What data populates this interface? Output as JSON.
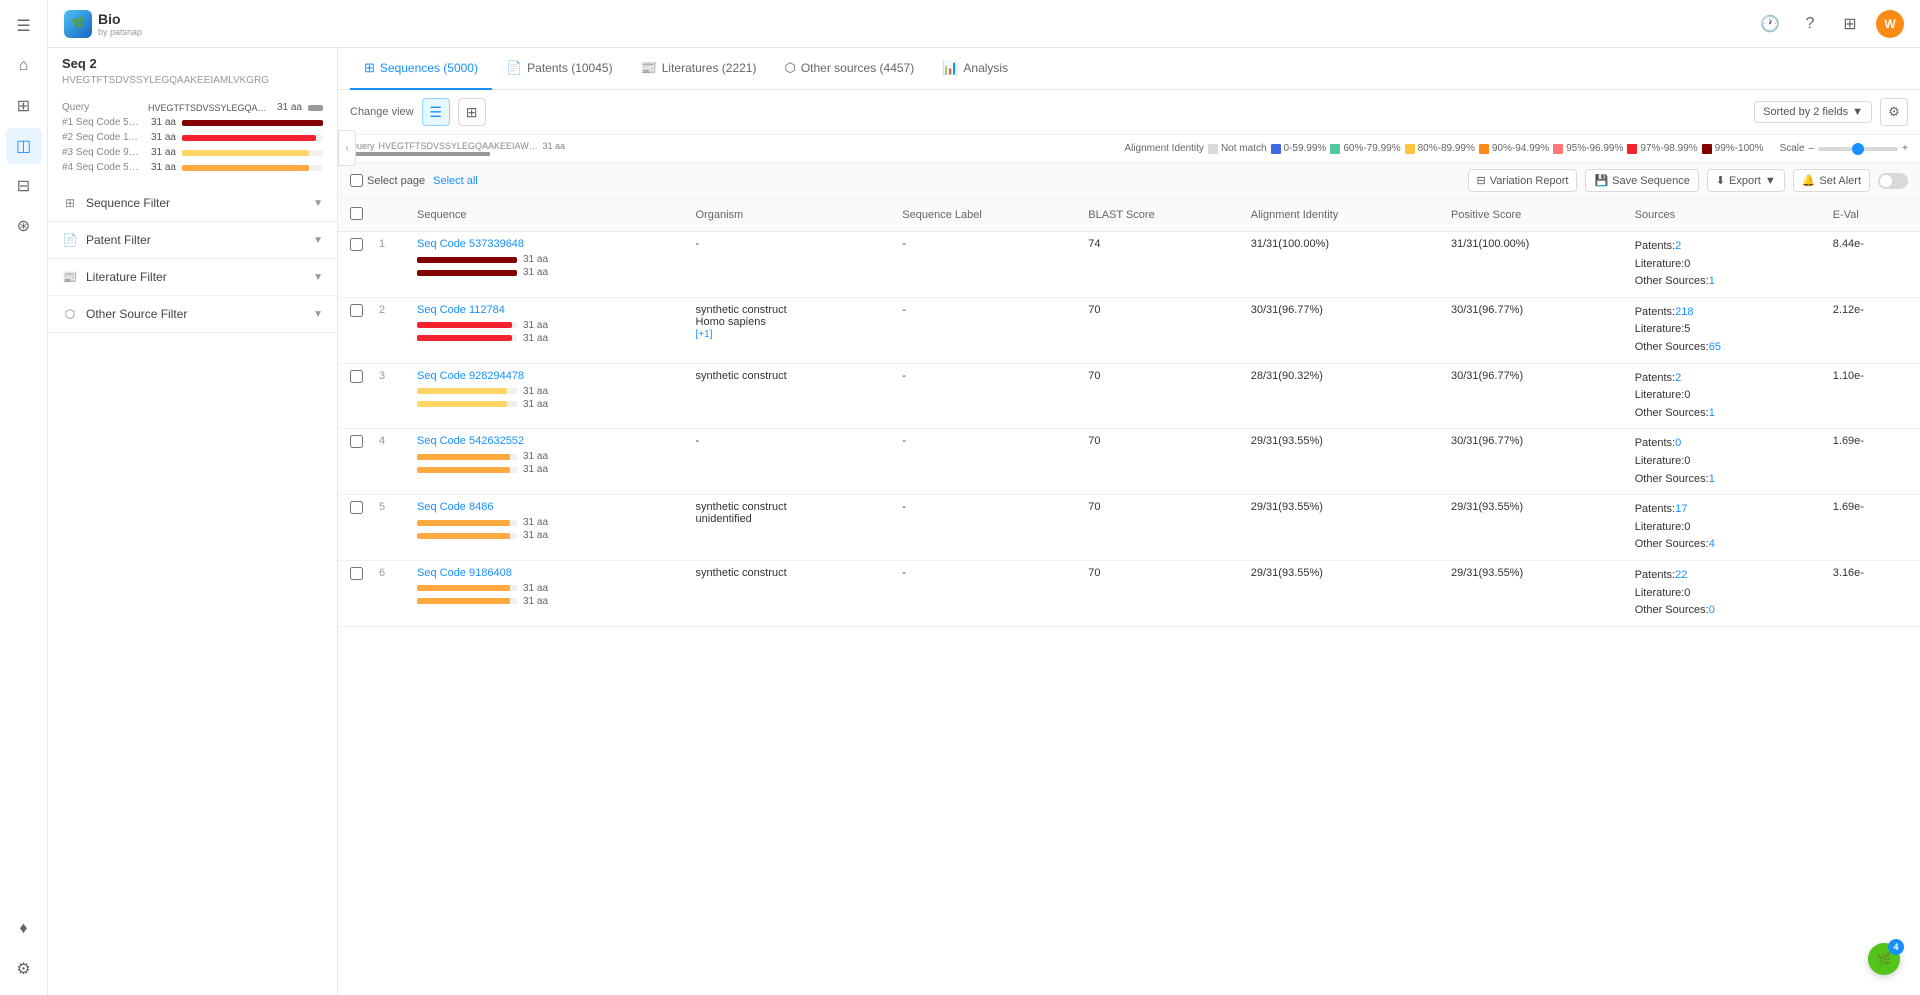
{
  "app": {
    "title": "Bio",
    "subtitle": "by patsnap",
    "user_initial": "W"
  },
  "query": {
    "name": "Seq 2",
    "sequence": "HVEGTFTSDVSSYLEGQAAKEEIAMLVKGRG"
  },
  "tabs": [
    {
      "id": "sequences",
      "label": "Sequences (5000)",
      "icon": "⊞",
      "active": true
    },
    {
      "id": "patents",
      "label": "Patents (10045)",
      "icon": "📄",
      "active": false
    },
    {
      "id": "literatures",
      "label": "Literatures (2221)",
      "icon": "📰",
      "active": false
    },
    {
      "id": "other_sources",
      "label": "Other sources (4457)",
      "icon": "⬡",
      "active": false
    },
    {
      "id": "analysis",
      "label": "Analysis",
      "icon": "📊",
      "active": false
    }
  ],
  "filters": [
    {
      "id": "sequence_filter",
      "label": "Sequence Filter",
      "icon": "⊞",
      "collapsed": false
    },
    {
      "id": "patent_filter",
      "label": "Patent Filter",
      "icon": "📄",
      "collapsed": false
    },
    {
      "id": "literature_filter",
      "label": "Literature Filter",
      "icon": "📰",
      "collapsed": false
    },
    {
      "id": "other_source_filter",
      "label": "Other Source Filter",
      "icon": "⬡",
      "collapsed": false
    }
  ],
  "alignment_preview": {
    "query_label": "Query",
    "query_seq": "HVEGTFTSDVSSYLEGQAAKEEIAWL...",
    "query_aa": "31 aa",
    "rows": [
      {
        "num": "#1",
        "label": "Seq Code 537339648",
        "aa": "31 aa",
        "color": "#c0392b"
      },
      {
        "num": "#2",
        "label": "Seq Code 112784",
        "aa": "31 aa",
        "color": "#c0392b"
      },
      {
        "num": "#3",
        "label": "Seq Code 928294478",
        "aa": "31 aa",
        "color": "#e67e22"
      },
      {
        "num": "#4",
        "label": "Seq Code 542632552",
        "aa": "31 aa",
        "color": "#e67e22"
      }
    ]
  },
  "legend": {
    "items": [
      {
        "label": "Not match",
        "color": "#d9d9d9"
      },
      {
        "label": "0-59.99%",
        "color": "#4169e1"
      },
      {
        "label": "60%-79.99%",
        "color": "#52c7a0"
      },
      {
        "label": "80%-89.99%",
        "color": "#ffc53d"
      },
      {
        "label": "90%-94.99%",
        "color": "#fa8c16"
      },
      {
        "label": "95%-96.99%",
        "color": "#ff7875"
      },
      {
        "label": "97%-98.99%",
        "color": "#f5222d"
      },
      {
        "label": "99%-100%",
        "color": "#820000"
      }
    ]
  },
  "toolbar": {
    "change_view_label": "Change view",
    "sorted_label": "Sorted by 2 fields",
    "scale_label": "Scale"
  },
  "actions": {
    "select_page": "Select page",
    "select_all": "Select all",
    "variation_report": "Variation Report",
    "save_sequence": "Save Sequence",
    "export": "Export",
    "set_alert": "Set Alert"
  },
  "table": {
    "columns": [
      "",
      "",
      "Sequence",
      "Organism",
      "Sequence Label",
      "BLAST Score",
      "Alignment Identity",
      "Positive Score",
      "Sources",
      "E-Val"
    ],
    "rows": [
      {
        "num": "1",
        "id": "Seq Code 537339648",
        "organism": "-",
        "label": "-",
        "blast_score": "74",
        "alignment_identity": "31/31(100.00%)",
        "positive_score": "31/31(100.00%)",
        "sources_patents": "2",
        "sources_literature": "0",
        "sources_other": "1",
        "e_value": "8.44e-",
        "bar1_width": "100%",
        "bar1_color": "#820000",
        "bar2_width": "100%",
        "bar2_color": "#820000"
      },
      {
        "num": "2",
        "id": "Seq Code 112784",
        "organism": "synthetic construct\nHomo sapiens",
        "organism_extra": "[+1]",
        "label": "-",
        "blast_score": "70",
        "alignment_identity": "30/31(96.77%)",
        "positive_score": "30/31(96.77%)",
        "sources_patents": "218",
        "sources_literature": "5",
        "sources_other": "65",
        "e_value": "2.12e-",
        "bar1_width": "95%",
        "bar1_color": "#f5222d",
        "bar2_width": "95%",
        "bar2_color": "#f5222d"
      },
      {
        "num": "3",
        "id": "Seq Code 928294478",
        "organism": "synthetic construct",
        "organism_extra": "",
        "label": "-",
        "blast_score": "70",
        "alignment_identity": "28/31(90.32%)",
        "positive_score": "30/31(96.77%)",
        "sources_patents": "2",
        "sources_literature": "0",
        "sources_other": "1",
        "e_value": "1.10e-",
        "bar1_width": "90%",
        "bar1_color": "#ffd666",
        "bar2_width": "90%",
        "bar2_color": "#ffd666"
      },
      {
        "num": "4",
        "id": "Seq Code 542632552",
        "organism": "-",
        "organism_extra": "",
        "label": "-",
        "blast_score": "70",
        "alignment_identity": "29/31(93.55%)",
        "positive_score": "30/31(96.77%)",
        "sources_patents": "0",
        "sources_literature": "0",
        "sources_other": "1",
        "e_value": "1.69e-",
        "bar1_width": "93%",
        "bar1_color": "#ffa940",
        "bar2_width": "93%",
        "bar2_color": "#ffa940"
      },
      {
        "num": "5",
        "id": "Seq Code 8486",
        "organism": "synthetic construct\nunidentified",
        "organism_extra": "",
        "label": "-",
        "blast_score": "70",
        "alignment_identity": "29/31(93.55%)",
        "positive_score": "29/31(93.55%)",
        "sources_patents": "17",
        "sources_literature": "0",
        "sources_other": "4",
        "e_value": "1.69e-",
        "bar1_width": "93%",
        "bar1_color": "#ffa940",
        "bar2_width": "93%",
        "bar2_color": "#ffa940"
      },
      {
        "num": "6",
        "id": "Seq Code 9186408",
        "organism": "synthetic construct",
        "organism_extra": "",
        "label": "-",
        "blast_score": "70",
        "alignment_identity": "29/31(93.55%)",
        "positive_score": "29/31(93.55%)",
        "sources_patents": "22",
        "sources_literature": "0",
        "sources_other": "0",
        "e_value": "3.16e-",
        "bar1_width": "93%",
        "bar1_color": "#ffa940",
        "bar2_width": "93%",
        "bar2_color": "#ffa940"
      }
    ]
  },
  "floating": {
    "badge_num": "4",
    "icon": "🌿"
  }
}
